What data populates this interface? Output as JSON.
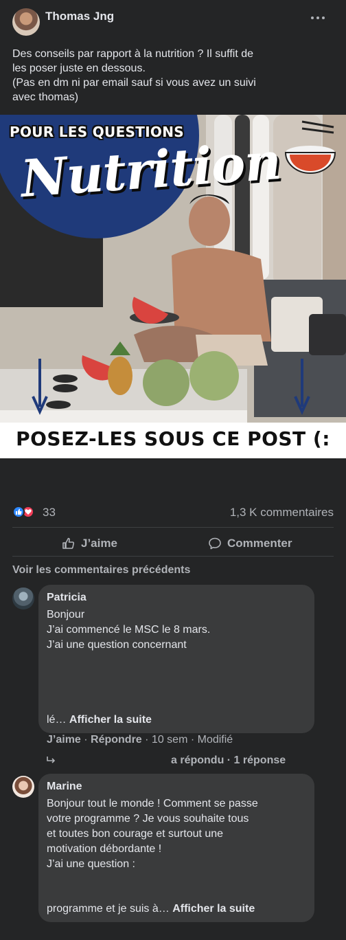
{
  "post": {
    "author": "Thomas Jng",
    "more_icon": "more-horizontal-icon",
    "text_lines": [
      "Des conseils par rapport à la nutrition ? Il suffit de",
      "les poser juste en dessous.",
      "(Pas en dm ni par email sauf si vous avez un suivi",
      "avec thomas)"
    ],
    "image": {
      "overlay_top": "POUR LES QUESTIONS",
      "overlay_script": "Nutrition",
      "banner": "POSEZ-LES SOUS CE POST (:"
    }
  },
  "stats": {
    "reactions_count": "33",
    "reaction_icons": [
      "like-reaction-icon",
      "love-reaction-icon"
    ],
    "comments_count": "1,3 K commentaires"
  },
  "actions": {
    "like_label": "J’aime",
    "comment_label": "Commenter"
  },
  "comments_section": {
    "previous_label": "Voir les commentaires précédents",
    "comments": [
      {
        "author": "Patricia",
        "lines": [
          "Bonjour",
          "J’ai commencé le MSC le 8 mars.",
          "J’ai une question concernant"
        ],
        "truncated_prefix": "lé…",
        "see_more": "Afficher la suite",
        "meta": {
          "like": "J’aime",
          "sep1": " · ",
          "reply": "Répondre",
          "sep2": " · ",
          "time": "10 sem",
          "sep3": " · ",
          "edited": "Modifié"
        },
        "reply_summary": "a répondu · 1 réponse"
      },
      {
        "author": "Marine",
        "lines": [
          "Bonjour tout le monde ! Comment se passe",
          "votre programme ? Je vous souhaite tous",
          "et toutes bon courage et surtout une",
          "motivation débordante !",
          "J’ai une question :"
        ],
        "truncated_prefix": "programme et je suis à…",
        "see_more": "Afficher la suite"
      }
    ]
  },
  "colors": {
    "background": "#242526",
    "bubble": "#3a3b3c",
    "primary_text": "#e4e6eb",
    "secondary_text": "#b0b3b8",
    "like_blue": "#2d88ff",
    "love_red": "#f33e58",
    "image_circle_blue": "#1f3a7a"
  }
}
